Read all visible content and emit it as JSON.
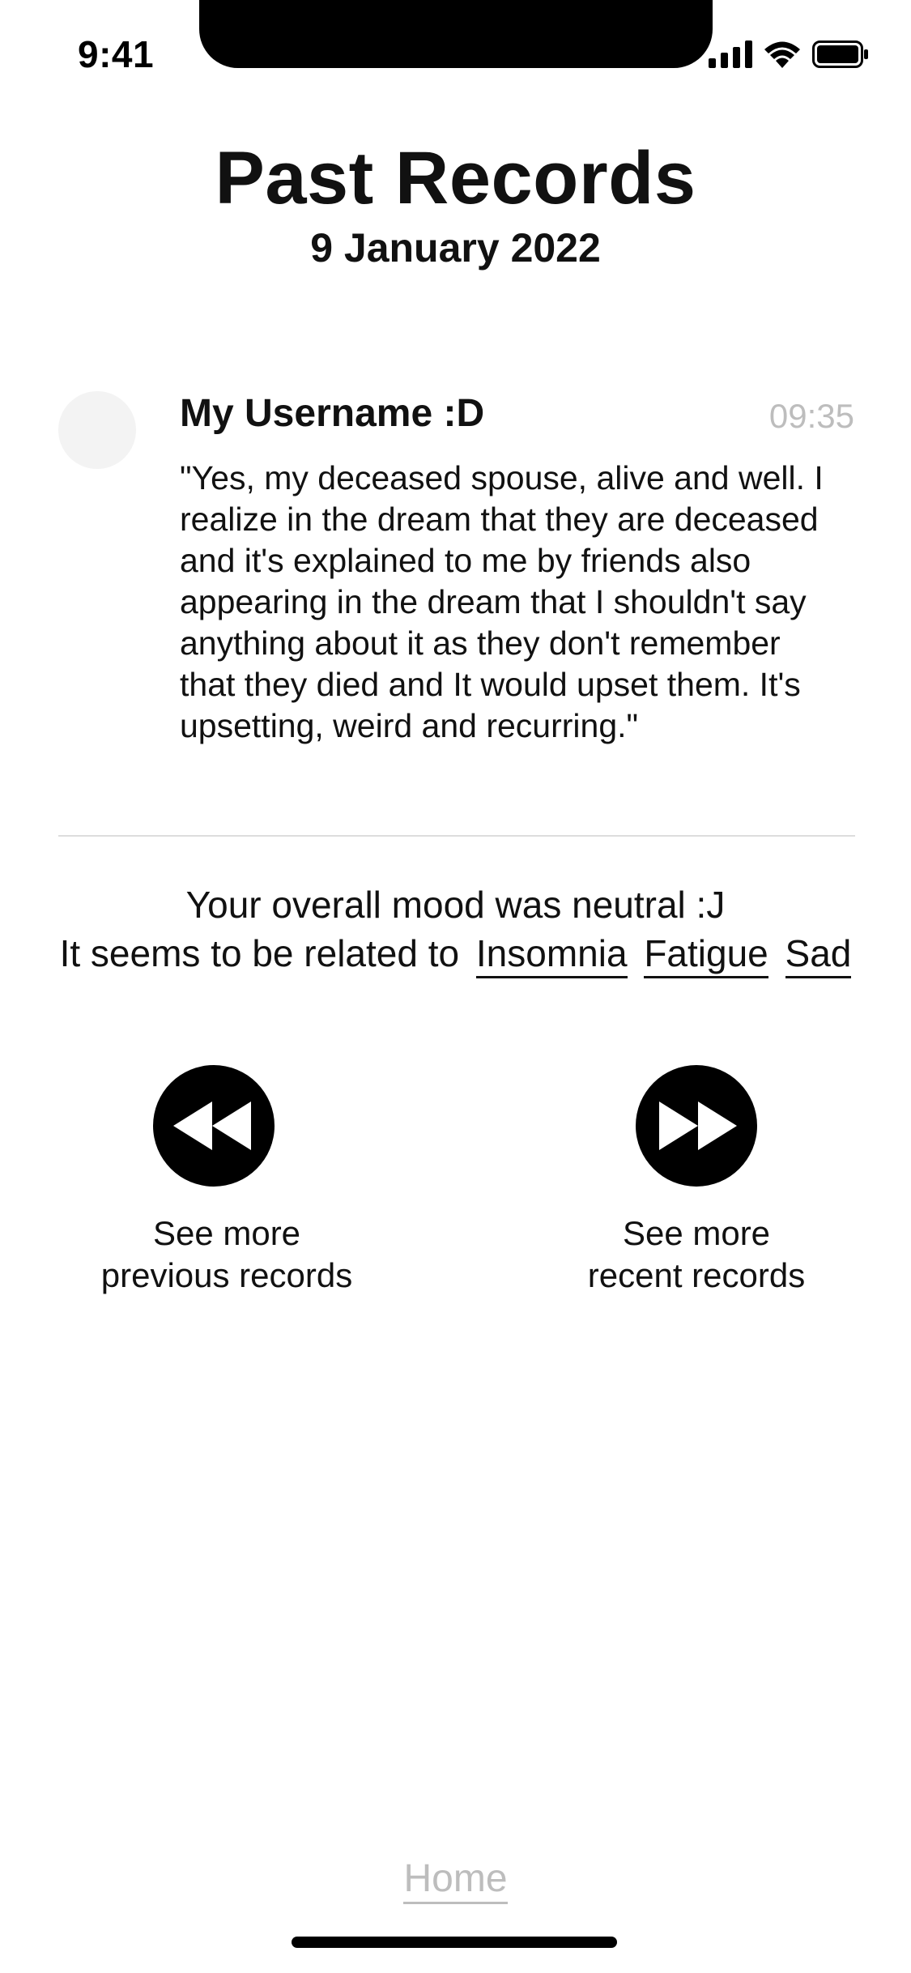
{
  "status_bar": {
    "time": "9:41"
  },
  "header": {
    "title": "Past Records",
    "date": "9 January 2022"
  },
  "record": {
    "username": "My Username :D",
    "time": "09:35",
    "text": "\"Yes, my deceased spouse, alive and well. I realize in the dream that they are deceased and it's explained to me by friends also appearing in the dream that I shouldn't say anything about it as they don't remember that they died and It would upset them. It's upsetting, weird and recurring.\""
  },
  "summary": {
    "mood_text": "Your overall mood was neutral :J",
    "related_prefix": "It seems to be related to",
    "tags": [
      "Insomnia",
      "Fatigue",
      "Sad"
    ]
  },
  "navigation": {
    "previous_line1": "See more",
    "previous_line2": "previous records",
    "recent_line1": "See more",
    "recent_line2": "recent records"
  },
  "footer": {
    "home_label": "Home"
  },
  "colors": {
    "text": "#111111",
    "muted": "#bdbdbd",
    "avatar": "#f3f3f3",
    "divider": "#dddddd"
  },
  "icons": {
    "previous": "rewind-icon",
    "recent": "fast-forward-icon"
  }
}
